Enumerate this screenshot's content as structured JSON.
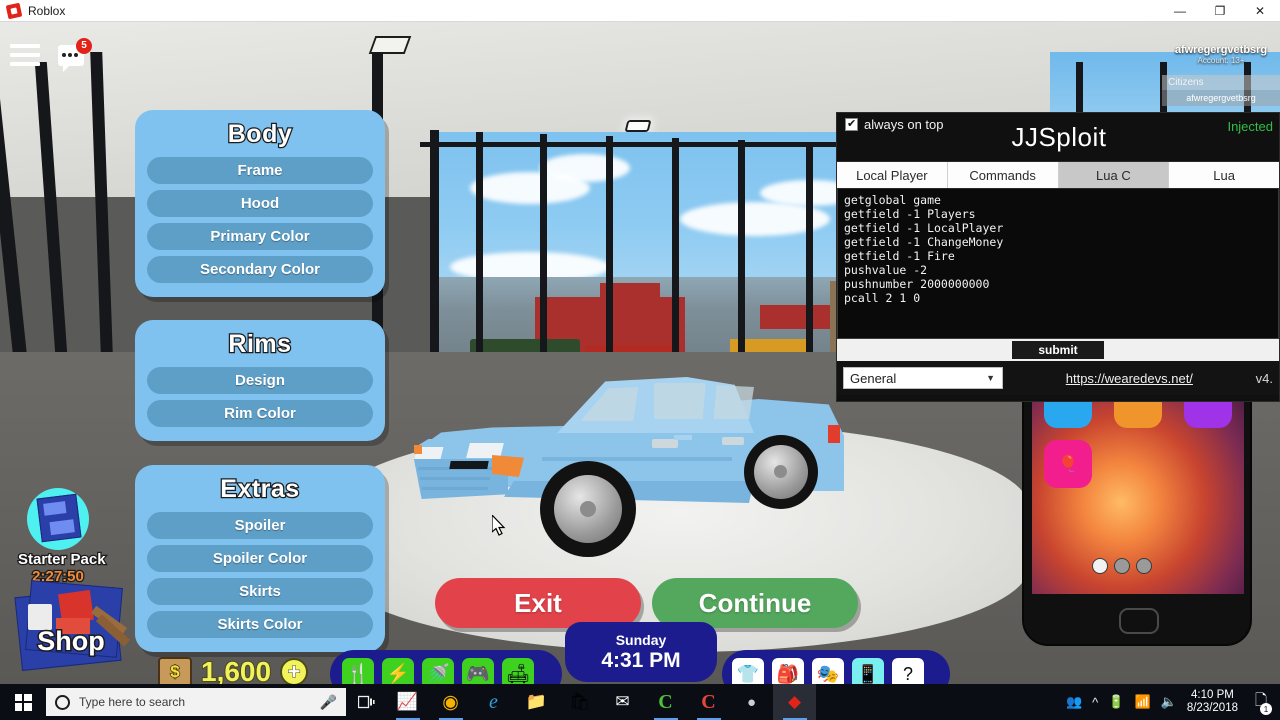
{
  "window": {
    "title": "Roblox",
    "app_icon": "roblox-icon",
    "minimize": "—",
    "maximize": "❐",
    "close": "✕"
  },
  "game_hud": {
    "menu_icon": "hamburger-menu-icon",
    "chat_icon": "chat-bubble-icon",
    "chat_badge": "5"
  },
  "player_list": {
    "name": "afwregergvetbsrg",
    "account": "Account: 13+",
    "team_header": "Citizens",
    "members": [
      "afwregergvetbsrg"
    ]
  },
  "customization": {
    "panels": [
      {
        "title": "Body",
        "options": [
          "Frame",
          "Hood",
          "Primary Color",
          "Secondary Color"
        ]
      },
      {
        "title": "Rims",
        "options": [
          "Design",
          "Rim Color"
        ]
      },
      {
        "title": "Extras",
        "options": [
          "Spoiler",
          "Spoiler Color",
          "Skirts",
          "Skirts Color"
        ]
      }
    ],
    "exit_label": "Exit",
    "continue_label": "Continue",
    "exit_color": "#e2434a",
    "continue_color": "#54a85e",
    "panel_color": "#7fc2f0",
    "option_color": "#5e9fc8"
  },
  "starter_pack": {
    "icon": "blueprint-icon",
    "label": "Starter Pack",
    "timer": "2:27:50",
    "timer_color": "#f08a39"
  },
  "shop": {
    "label": "Shop",
    "icon": "furniture-blueprint-icon"
  },
  "bottom_hud": {
    "cash_icon": "money-bag-icon",
    "cash_symbol": "$",
    "cash_amount": "1,600",
    "add_cash_icon": "plus-icon",
    "needs": [
      {
        "name": "hunger-need-icon",
        "glyph": "🍴"
      },
      {
        "name": "energy-need-icon",
        "glyph": "⚡"
      },
      {
        "name": "hygiene-need-icon",
        "glyph": "🚿"
      },
      {
        "name": "fun-need-icon",
        "glyph": "🎮"
      },
      {
        "name": "comfort-need-icon",
        "glyph": "🛋"
      }
    ],
    "clock_day": "Sunday",
    "clock_time": "4:31 PM",
    "menu_items": [
      {
        "name": "clothing-menu-icon",
        "glyph": "👕",
        "highlighted": false
      },
      {
        "name": "backpack-menu-icon",
        "glyph": "🎒",
        "highlighted": false
      },
      {
        "name": "emotes-menu-icon",
        "glyph": "🎭",
        "highlighted": false
      },
      {
        "name": "phone-menu-icon",
        "glyph": "📱",
        "highlighted": true
      },
      {
        "name": "help-menu-icon",
        "glyph": "?",
        "highlighted": false
      }
    ]
  },
  "jjsploit": {
    "always_on_top_label": "always on top",
    "always_on_top_checked": true,
    "title": "JJSploit",
    "status": "Injected",
    "status_color": "#2fbf46",
    "tabs": [
      {
        "label": "Local Player",
        "active": false
      },
      {
        "label": "Commands",
        "active": false
      },
      {
        "label": "Lua C",
        "active": true
      },
      {
        "label": "Lua",
        "active": false
      }
    ],
    "console_lines": [
      "getglobal game",
      "getfield -1 Players",
      "getfield -1 LocalPlayer",
      "getfield -1 ChangeMoney",
      "getfield -1 Fire",
      "pushvalue -2",
      "pushnumber 2000000000",
      "pcall 2 1 0"
    ],
    "submit_label": "submit",
    "select_value": "General",
    "select_caret": "▼",
    "link": "https://wearedevs.net/",
    "version": "v4."
  },
  "phone": {
    "apps": [
      {
        "name": "app-blue",
        "color": "#2aa8ef",
        "glyph": ""
      },
      {
        "name": "app-orange",
        "color": "#f0952b",
        "glyph": ""
      },
      {
        "name": "app-purple",
        "color": "#a032e8",
        "glyph": ""
      },
      {
        "name": "app-party",
        "color": "#f31e8e",
        "glyph": "🎈"
      }
    ],
    "page_dots": 3,
    "active_dot": 0,
    "home_button": "home-button"
  },
  "taskbar": {
    "start_label": "start-button",
    "search_placeholder": "Type here to search",
    "search_icon": "search-circle-icon",
    "mic_icon": "microphone-icon",
    "taskview_icon": "task-view-icon",
    "apps": [
      {
        "name": "taskbar-task-manager",
        "glyph": "📈",
        "open": true,
        "active": false
      },
      {
        "name": "taskbar-chrome",
        "glyph": "◉",
        "open": true,
        "active": false
      },
      {
        "name": "taskbar-edge",
        "glyph": "e",
        "open": false,
        "active": false
      },
      {
        "name": "taskbar-file-explorer",
        "glyph": "📁",
        "open": false,
        "active": false
      },
      {
        "name": "taskbar-store",
        "glyph": "🛎",
        "open": false,
        "active": false
      },
      {
        "name": "taskbar-mail",
        "glyph": "✉",
        "open": false,
        "active": false
      },
      {
        "name": "taskbar-camtasia",
        "glyph": "C",
        "open": true,
        "active": false
      },
      {
        "name": "taskbar-camtasia-rec",
        "glyph": "C",
        "open": true,
        "active": false
      },
      {
        "name": "taskbar-obs",
        "glyph": "●",
        "open": false,
        "active": false
      },
      {
        "name": "taskbar-roblox",
        "glyph": "◆",
        "open": true,
        "active": true
      }
    ],
    "tray": {
      "people_icon": "people-icon",
      "chevron_icon": "show-hidden-icons-icon",
      "battery_icon": "battery-icon",
      "wifi_icon": "wifi-icon",
      "volume_icon": "volume-icon",
      "time": "4:10 PM",
      "date": "8/23/2018",
      "notification_icon": "action-center-icon",
      "notification_count": "1"
    }
  }
}
